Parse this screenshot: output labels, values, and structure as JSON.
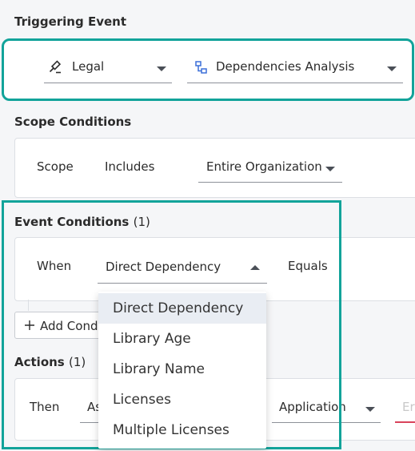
{
  "triggering": {
    "title": "Triggering Event",
    "category_value": "Legal",
    "category_icon": "gavel-icon",
    "event_value": "Dependencies Analysis",
    "event_icon": "flow-icon"
  },
  "scope": {
    "title": "Scope Conditions",
    "label": "Scope",
    "operator": "Includes",
    "value": "Entire Organization"
  },
  "event_conditions": {
    "title": "Event Conditions",
    "count": "(1)",
    "when_label": "When",
    "field_value": "Direct Dependency",
    "operator": "Equals",
    "add_button": "Add Cond",
    "add_icon": "plus-icon"
  },
  "dropdown": {
    "options": [
      "Direct Dependency",
      "Library Age",
      "Library Name",
      "Licenses",
      "Multiple Licenses"
    ],
    "selected": "Direct Dependency"
  },
  "actions": {
    "title": "Actions",
    "count": "(1)",
    "then_label": "Then",
    "action_partial": "As",
    "target_value": "Application",
    "partial_right": "Er"
  },
  "colors": {
    "highlight": "#12a39a",
    "error_underline": "#d9435b"
  }
}
